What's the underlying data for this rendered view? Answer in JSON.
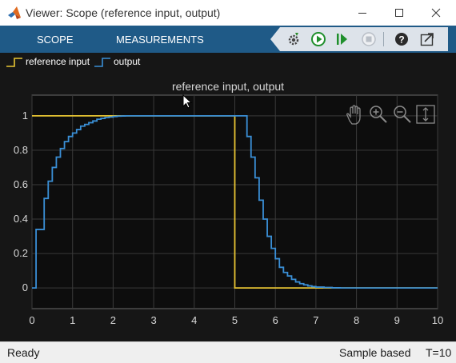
{
  "window": {
    "title": "Viewer: Scope (reference input, output)",
    "controls": [
      "minimize-icon",
      "maximize-icon",
      "close-icon"
    ]
  },
  "tabs": [
    {
      "label": "SCOPE"
    },
    {
      "label": "MEASUREMENTS"
    }
  ],
  "toolbar": {
    "icons": [
      "settings-gear-icon",
      "run-icon",
      "step-forward-icon",
      "stop-icon",
      "help-icon",
      "undock-icon"
    ],
    "stop_enabled": false
  },
  "legend": [
    {
      "label": "reference input",
      "color": "#e8c533"
    },
    {
      "label": "output",
      "color": "#3a8fd6"
    }
  ],
  "plot_tools": [
    "pan-hand-icon",
    "zoom-in-icon",
    "zoom-out-icon",
    "fit-to-view-icon"
  ],
  "status": {
    "state": "Ready",
    "mode": "Sample based",
    "time": "T=10"
  },
  "chart_data": {
    "type": "line",
    "title": "reference input, output",
    "xlim": [
      0,
      10
    ],
    "ylim": [
      -0.12,
      1.12
    ],
    "xticks": [
      0,
      1,
      2,
      3,
      4,
      5,
      6,
      7,
      8,
      9,
      10
    ],
    "yticks": [
      0,
      0.2,
      0.4,
      0.6,
      0.8,
      1
    ],
    "ytick_labels": [
      "0",
      "0.2",
      "0.4",
      "0.6",
      "0.8",
      "1"
    ],
    "grid": true,
    "legend_position": "top-left",
    "series": [
      {
        "name": "reference input",
        "color": "#e8c533",
        "step": true,
        "x": [
          0,
          5,
          10
        ],
        "y": [
          1,
          0,
          0
        ]
      },
      {
        "name": "output",
        "color": "#3a8fd6",
        "step": true,
        "x": [
          0,
          0.1,
          0.3,
          0.4,
          0.5,
          0.6,
          0.7,
          0.8,
          0.9,
          1.0,
          1.1,
          1.2,
          1.3,
          1.4,
          1.5,
          1.6,
          1.7,
          1.8,
          1.9,
          2.0,
          2.1,
          2.2,
          2.3,
          5.3,
          5.4,
          5.5,
          5.6,
          5.7,
          5.8,
          5.9,
          6.0,
          6.1,
          6.2,
          6.3,
          6.4,
          6.5,
          6.6,
          6.7,
          6.8,
          6.9,
          7.0,
          7.2,
          7.4,
          7.6,
          10
        ],
        "y": [
          0,
          0.34,
          0.52,
          0.62,
          0.7,
          0.76,
          0.81,
          0.85,
          0.88,
          0.9,
          0.92,
          0.94,
          0.95,
          0.96,
          0.97,
          0.98,
          0.985,
          0.99,
          0.993,
          0.996,
          0.998,
          0.999,
          1.0,
          0.88,
          0.76,
          0.64,
          0.51,
          0.4,
          0.3,
          0.23,
          0.17,
          0.12,
          0.09,
          0.07,
          0.05,
          0.035,
          0.025,
          0.018,
          0.012,
          0.008,
          0.005,
          0.003,
          0.001,
          0,
          0
        ]
      }
    ]
  }
}
